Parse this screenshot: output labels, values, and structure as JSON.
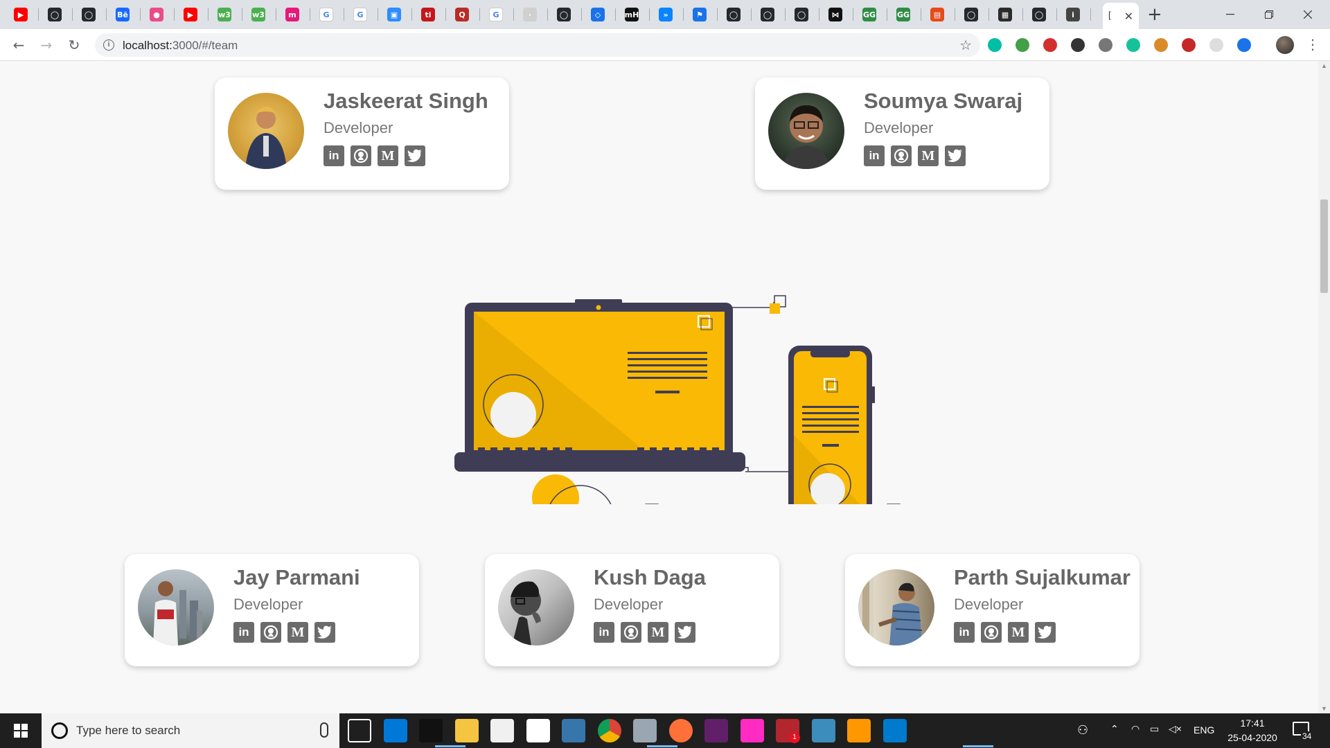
{
  "browser": {
    "active_tab_title": "[",
    "url_host": "localhost:",
    "url_path": "3000/#/team",
    "tabs": [
      {
        "icon": "youtube-icon",
        "color": "#ff0000",
        "glyph": "▶"
      },
      {
        "icon": "github-icon",
        "color": "#24292e",
        "glyph": "◯"
      },
      {
        "icon": "github-icon",
        "color": "#24292e",
        "glyph": "◯"
      },
      {
        "icon": "behance-icon",
        "color": "#1769ff",
        "glyph": "Bē"
      },
      {
        "icon": "dribbble-icon",
        "color": "#ea4c89",
        "glyph": "●"
      },
      {
        "icon": "youtube-icon",
        "color": "#ff0000",
        "glyph": "▶"
      },
      {
        "icon": "w3schools-icon",
        "color": "#4caf50",
        "glyph": "w3"
      },
      {
        "icon": "w3schools-icon",
        "color": "#4caf50",
        "glyph": "w3"
      },
      {
        "icon": "mailchimp-icon",
        "color": "#e5197a",
        "glyph": "m"
      },
      {
        "icon": "google-icon",
        "color": "#ffffff",
        "glyph": "G"
      },
      {
        "icon": "google-icon",
        "color": "#ffffff",
        "glyph": "G"
      },
      {
        "icon": "zoom-icon",
        "color": "#2d8cff",
        "glyph": "▣"
      },
      {
        "icon": "hackerearth-icon",
        "color": "#c4161c",
        "glyph": "ti"
      },
      {
        "icon": "quora-icon",
        "color": "#b92b27",
        "glyph": "Q"
      },
      {
        "icon": "google-icon",
        "color": "#ffffff",
        "glyph": "G"
      },
      {
        "icon": "generic-icon",
        "color": "#d0d0d0",
        "glyph": "·"
      },
      {
        "icon": "github-icon",
        "color": "#24292e",
        "glyph": "◯"
      },
      {
        "icon": "git-icon",
        "color": "#1a73e8",
        "glyph": "◇"
      },
      {
        "icon": "mh-icon",
        "color": "#111111",
        "glyph": "mH"
      },
      {
        "icon": "vscode-live-icon",
        "color": "#0a84ff",
        "glyph": "»"
      },
      {
        "icon": "bookmark-icon",
        "color": "#1a73e8",
        "glyph": "⚑"
      },
      {
        "icon": "github-icon",
        "color": "#24292e",
        "glyph": "◯"
      },
      {
        "icon": "github-icon",
        "color": "#24292e",
        "glyph": "◯"
      },
      {
        "icon": "github-icon",
        "color": "#24292e",
        "glyph": "◯"
      },
      {
        "icon": "tie-icon",
        "color": "#111111",
        "glyph": "⋈"
      },
      {
        "icon": "geeksforgeeks-icon",
        "color": "#2f8d46",
        "glyph": "GG"
      },
      {
        "icon": "geeksforgeeks-icon",
        "color": "#2f8d46",
        "glyph": "GG"
      },
      {
        "icon": "pdf-icon",
        "color": "#e64a19",
        "glyph": "▤"
      },
      {
        "icon": "github-icon",
        "color": "#24292e",
        "glyph": "◯"
      },
      {
        "icon": "terminal-icon",
        "color": "#2b2b2b",
        "glyph": "▦"
      },
      {
        "icon": "github-icon",
        "color": "#24292e",
        "glyph": "◯"
      },
      {
        "icon": "generic-icon",
        "color": "#444444",
        "glyph": "i"
      }
    ],
    "extensions": [
      {
        "icon": "extension-teal-icon",
        "color": "#00bfa5"
      },
      {
        "icon": "extension-shield-icon",
        "color": "#43a047"
      },
      {
        "icon": "extension-pdf-icon",
        "color": "#d32f2f"
      },
      {
        "icon": "extension-sync-icon",
        "color": "#333333"
      },
      {
        "icon": "extension-brain-icon",
        "color": "#777777"
      },
      {
        "icon": "grammarly-icon",
        "color": "#15c39a"
      },
      {
        "icon": "cookie-icon",
        "color": "#d98b2b"
      },
      {
        "icon": "extension-red-icon",
        "color": "#c62828"
      },
      {
        "icon": "extension-clock-icon",
        "color": "#dddddd"
      },
      {
        "icon": "translate-icon",
        "color": "#1a73e8"
      }
    ]
  },
  "team": {
    "members": [
      {
        "name": "Jaskeerat Singh",
        "role": "Developer"
      },
      {
        "name": "Soumya Swaraj",
        "role": "Developer"
      },
      {
        "name": "Jay Parmani",
        "role": "Developer"
      },
      {
        "name": "Kush Daga",
        "role": "Developer"
      },
      {
        "name": "Parth Sujalkumar",
        "role": "Developer"
      }
    ],
    "social": {
      "linkedin": "in",
      "github": "github-icon",
      "medium": "M",
      "twitter": "twitter-icon"
    }
  },
  "colors": {
    "accent_yellow": "#f9b905",
    "dark_device": "#3f3d56",
    "card_text": "#666666"
  },
  "taskbar": {
    "search_placeholder": "Type here to search",
    "language": "ENG",
    "time": "17:41",
    "date": "25-04-2020",
    "notification_count": "34",
    "chrome_badge": "1",
    "apps": [
      {
        "icon": "task-view-icon"
      },
      {
        "icon": "edge-icon"
      },
      {
        "icon": "terminal-icon"
      },
      {
        "icon": "file-explorer-icon"
      },
      {
        "icon": "store-icon"
      },
      {
        "icon": "mail-icon"
      },
      {
        "icon": "python-icon"
      },
      {
        "icon": "chrome-icon"
      },
      {
        "icon": "photos-icon"
      },
      {
        "icon": "firefox-icon"
      },
      {
        "icon": "slack-icon"
      },
      {
        "icon": "adobe-xd-icon"
      },
      {
        "icon": "winrar-icon"
      },
      {
        "icon": "image-viewer-icon"
      },
      {
        "icon": "sublime-text-icon"
      },
      {
        "icon": "vscode-icon"
      }
    ]
  }
}
